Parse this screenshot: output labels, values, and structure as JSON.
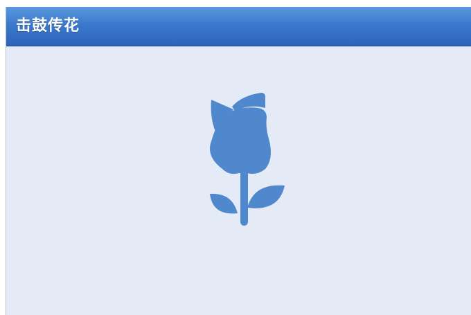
{
  "window": {
    "title": "击鼓传花"
  },
  "content": {
    "icon": "flower-icon",
    "icon_color": "#4f88cd"
  },
  "colors": {
    "title_bar": "#3c79cc",
    "background": "#e5ebf6"
  }
}
